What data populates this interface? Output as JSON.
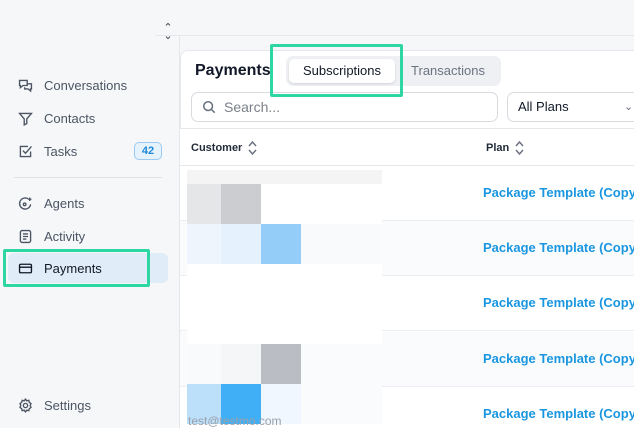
{
  "sidebar": {
    "items": [
      {
        "label": "Conversations",
        "icon": "chat-bubbles-icon"
      },
      {
        "label": "Contacts",
        "icon": "filter-funnel-icon"
      },
      {
        "label": "Tasks",
        "icon": "checkbox-icon",
        "badge": "42"
      },
      {
        "label": "Agents",
        "icon": "agent-sparkle-icon"
      },
      {
        "label": "Activity",
        "icon": "activity-list-icon"
      },
      {
        "label": "Payments",
        "icon": "credit-card-icon",
        "active": true
      },
      {
        "label": "Settings",
        "icon": "gear-icon"
      }
    ]
  },
  "main": {
    "title": "Payments",
    "tabs": [
      {
        "label": "Subscriptions",
        "selected": true
      },
      {
        "label": "Transactions",
        "selected": false
      }
    ],
    "search": {
      "placeholder": "Search..."
    },
    "plan_filter": {
      "selected": "All Plans"
    }
  },
  "table": {
    "columns": [
      "Customer",
      "Plan"
    ],
    "rows": [
      {
        "plan": "Package Template (Copy"
      },
      {
        "plan": "Package Template (Copy"
      },
      {
        "plan": "Package Template (Copy"
      },
      {
        "plan": "Package Template (Copy"
      },
      {
        "plan": "Package Template (Copy"
      }
    ],
    "partial_email": "test@testmo.com"
  },
  "colors": {
    "accent": "#1a96e0",
    "highlight": "#2ed6a3",
    "active_nav_bg": "#e0ecf8"
  }
}
